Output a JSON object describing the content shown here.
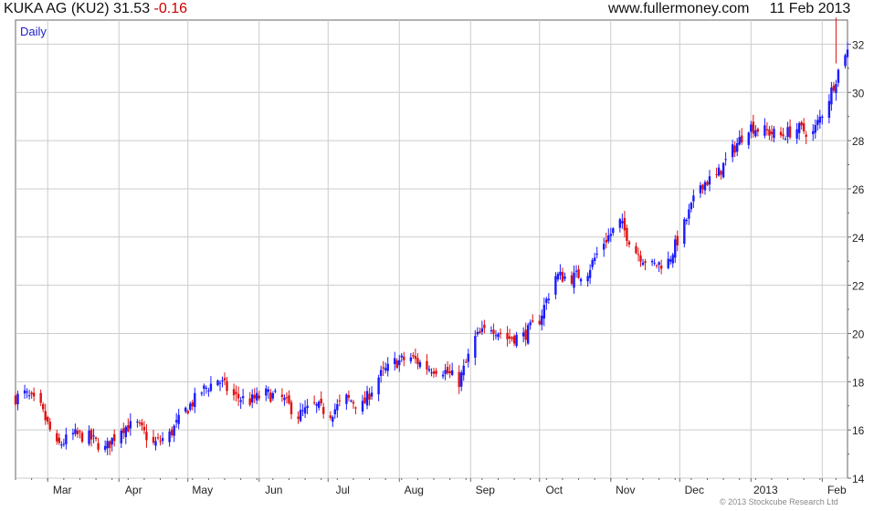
{
  "header": {
    "name": "KUKA AG (KU2)",
    "price": "31.53",
    "change": "-0.16",
    "site": "www.fullermoney.com",
    "date": "11 Feb 2013"
  },
  "copyright": "© 2013 Stockcube Research Ltd",
  "colors": {
    "up": "#1a1aff",
    "down": "#e01010",
    "grid": "#cccccc",
    "frame": "#666666"
  },
  "chart_data": {
    "type": "candlestick",
    "period_label": "Daily",
    "ylim": [
      14,
      33
    ],
    "yticks": [
      14,
      16,
      18,
      20,
      22,
      24,
      26,
      28,
      30,
      32
    ],
    "xlim": [
      "2013-02-16",
      "2013-02-12"
    ],
    "x_ticks": [
      {
        "label": "Mar",
        "date": "2012-03-01"
      },
      {
        "label": "Apr",
        "date": "2012-04-01"
      },
      {
        "label": "May",
        "date": "2012-05-01"
      },
      {
        "label": "Jun",
        "date": "2012-06-01"
      },
      {
        "label": "Jul",
        "date": "2012-07-01"
      },
      {
        "label": "Aug",
        "date": "2012-08-01"
      },
      {
        "label": "Sep",
        "date": "2012-09-01"
      },
      {
        "label": "Oct",
        "date": "2012-10-01"
      },
      {
        "label": "Nov",
        "date": "2012-11-01"
      },
      {
        "label": "Dec",
        "date": "2012-12-01"
      },
      {
        "label": "2013",
        "date": "2013-01-01"
      },
      {
        "label": "Feb",
        "date": "2013-02-01"
      }
    ],
    "grid": true,
    "closes": [
      [
        "2012-02-13",
        17.2
      ],
      [
        "2012-02-20",
        17.5
      ],
      [
        "2012-02-27",
        16.9
      ],
      [
        "2012-03-05",
        15.3
      ],
      [
        "2012-03-12",
        15.8
      ],
      [
        "2012-03-19",
        15.7
      ],
      [
        "2012-03-26",
        15.2
      ],
      [
        "2012-04-02",
        16.1
      ],
      [
        "2012-04-09",
        16.2
      ],
      [
        "2012-04-16",
        15.4
      ],
      [
        "2012-04-23",
        15.8
      ],
      [
        "2012-04-30",
        16.8
      ],
      [
        "2012-05-07",
        17.6
      ],
      [
        "2012-05-14",
        18.1
      ],
      [
        "2012-05-21",
        17.4
      ],
      [
        "2012-05-28",
        17.2
      ],
      [
        "2012-06-04",
        17.5
      ],
      [
        "2012-06-11",
        17.3
      ],
      [
        "2012-06-18",
        16.6
      ],
      [
        "2012-06-25",
        17.0
      ],
      [
        "2012-07-02",
        16.7
      ],
      [
        "2012-07-09",
        17.3
      ],
      [
        "2012-07-16",
        17.0
      ],
      [
        "2012-07-23",
        18.2
      ],
      [
        "2012-07-30",
        18.8
      ],
      [
        "2012-08-06",
        19.0
      ],
      [
        "2012-08-13",
        18.6
      ],
      [
        "2012-08-20",
        18.5
      ],
      [
        "2012-08-27",
        18.0
      ],
      [
        "2012-09-03",
        19.8
      ],
      [
        "2012-09-10",
        20.3
      ],
      [
        "2012-09-17",
        19.8
      ],
      [
        "2012-09-24",
        19.9
      ],
      [
        "2012-10-01",
        20.6
      ],
      [
        "2012-10-08",
        22.4
      ],
      [
        "2012-10-15",
        22.3
      ],
      [
        "2012-10-22",
        22.6
      ],
      [
        "2012-10-29",
        23.8
      ],
      [
        "2012-11-05",
        24.6
      ],
      [
        "2012-11-12",
        23.4
      ],
      [
        "2012-11-19",
        22.8
      ],
      [
        "2012-11-26",
        23.0
      ],
      [
        "2012-12-03",
        24.5
      ],
      [
        "2012-12-10",
        26.2
      ],
      [
        "2012-12-17",
        26.5
      ],
      [
        "2012-12-24",
        27.6
      ],
      [
        "2012-12-31",
        28.6
      ],
      [
        "2013-01-07",
        28.4
      ],
      [
        "2013-01-14",
        28.2
      ],
      [
        "2013-01-21",
        28.5
      ],
      [
        "2013-01-28",
        28.3
      ],
      [
        "2013-02-04",
        29.8
      ],
      [
        "2013-02-11",
        31.7
      ]
    ],
    "spikes": [
      [
        "2013-02-07",
        31.2,
        33.1
      ]
    ]
  }
}
